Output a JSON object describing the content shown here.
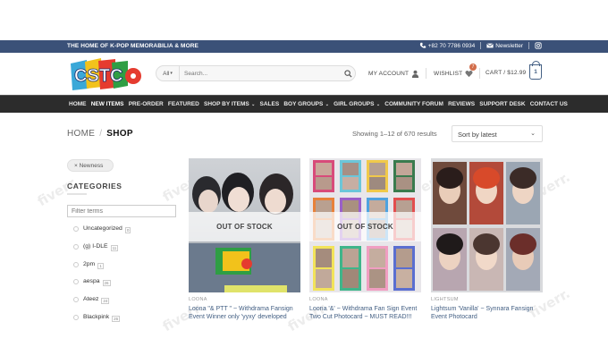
{
  "topbar": {
    "tagline": "THE HOME OF K-POP MEMORABILIA & MORE",
    "phone": "+82 70 7786 0934",
    "newsletter": "Newsletter"
  },
  "header": {
    "logo_text": "CSTC",
    "search": {
      "category": "All",
      "placeholder": "Search..."
    },
    "account_label": "MY ACCOUNT",
    "wishlist_label": "WISHLIST",
    "wishlist_count": "7",
    "cart_label": "CART / $12.99",
    "cart_count": "1"
  },
  "nav": {
    "items": [
      {
        "label": "HOME"
      },
      {
        "label": "NEW ITEMS"
      },
      {
        "label": "PRE-ORDER"
      },
      {
        "label": "FEATURED"
      },
      {
        "label": "SHOP BY ITEMS"
      },
      {
        "label": "SALES"
      },
      {
        "label": "BOY GROUPS"
      },
      {
        "label": "GIRL GROUPS"
      },
      {
        "label": "COMMUNITY FORUM"
      },
      {
        "label": "REVIEWS"
      },
      {
        "label": "SUPPORT DESK"
      },
      {
        "label": "CONTACT US"
      }
    ]
  },
  "breadcrumb": {
    "home": "HOME",
    "sep": "/",
    "current": "SHOP"
  },
  "results_text": "Showing 1–12 of 670 results",
  "sort": {
    "selected": "Sort by latest"
  },
  "sidebar": {
    "active_filter": "Newness",
    "categories_title": "CATEGORIES",
    "filter_placeholder": "Filter terms",
    "categories": [
      {
        "name": "Uncategorized",
        "count": "0"
      },
      {
        "name": "(g) I-DLE",
        "count": "11"
      },
      {
        "name": "2pm",
        "count": "1"
      },
      {
        "name": "aespa",
        "count": "26"
      },
      {
        "name": "Ateez",
        "count": "24"
      },
      {
        "name": "Blackpink",
        "count": "26"
      }
    ]
  },
  "products": [
    {
      "category": "LOONA",
      "title": "Loona \"& PTT \" ~ Withdrama Fansign Event Winner only 'yyxy' developed",
      "badge": "OUT OF STOCK"
    },
    {
      "category": "LOONA",
      "title": "Loona '&' ~ Withdrama Fan Sign Event Two Cut Photocard ~ MUST READ!!!",
      "badge": "OUT OF STOCK"
    },
    {
      "category": "LIGHTSUM",
      "title": "Lightsum 'Vanilla' ~ Synnara Fansign Event Photocard",
      "badge": ""
    }
  ],
  "watermark": "fiverr."
}
